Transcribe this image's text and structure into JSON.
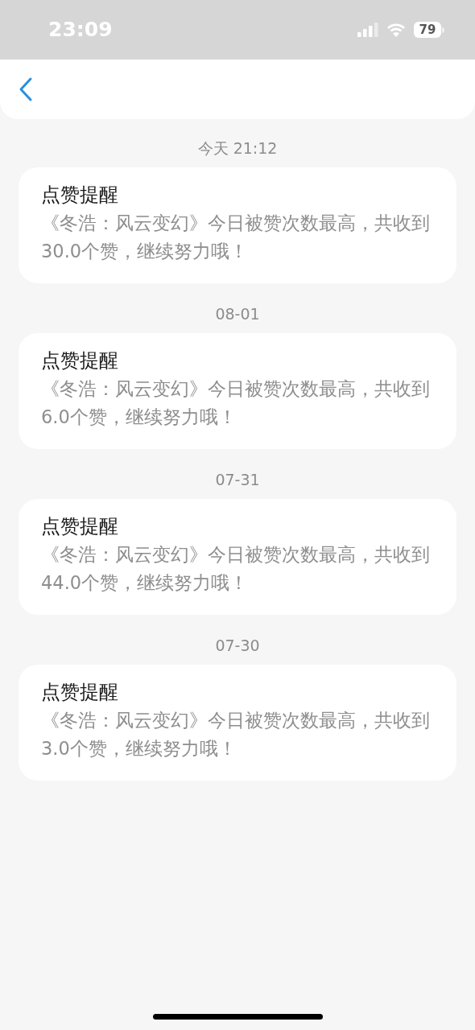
{
  "status_bar": {
    "time": "23:09",
    "battery": "79"
  },
  "notifications": [
    {
      "date": "今天 21:12",
      "title": "点赞提醒",
      "body": "《冬浩：风云变幻》今日被赞次数最高，共收到30.0个赞，继续努力哦！"
    },
    {
      "date": "08-01",
      "title": "点赞提醒",
      "body": "《冬浩：风云变幻》今日被赞次数最高，共收到6.0个赞，继续努力哦！"
    },
    {
      "date": "07-31",
      "title": "点赞提醒",
      "body": "《冬浩：风云变幻》今日被赞次数最高，共收到44.0个赞，继续努力哦！"
    },
    {
      "date": "07-30",
      "title": "点赞提醒",
      "body": "《冬浩：风云变幻》今日被赞次数最高，共收到3.0个赞，继续努力哦！"
    }
  ]
}
